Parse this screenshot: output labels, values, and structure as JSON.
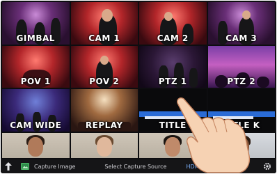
{
  "sources": [
    {
      "label": "GIMBAL",
      "look": "stage-purple"
    },
    {
      "label": "CAM 1",
      "look": "stage-red"
    },
    {
      "label": "CAM 2",
      "look": "stage-red"
    },
    {
      "label": "CAM 3",
      "look": "stage-purple"
    },
    {
      "label": "POV 1",
      "look": "stage-red"
    },
    {
      "label": "POV 2",
      "look": "stage-red"
    },
    {
      "label": "PTZ 1",
      "look": "stage-dark"
    },
    {
      "label": "PTZ 2",
      "look": "stage-crowd"
    },
    {
      "label": "CAM WIDE",
      "look": "stage-blue"
    },
    {
      "label": "REPLAY",
      "look": "stage-replay"
    },
    {
      "label": "TITLE",
      "look": "title"
    },
    {
      "label": "TITLE K",
      "look": "title"
    }
  ],
  "webcams": 4,
  "toolbar": {
    "capture_image_label": "Capture Image",
    "select_source_label": "Select Capture Source",
    "hdmi_label": "HDMI"
  }
}
